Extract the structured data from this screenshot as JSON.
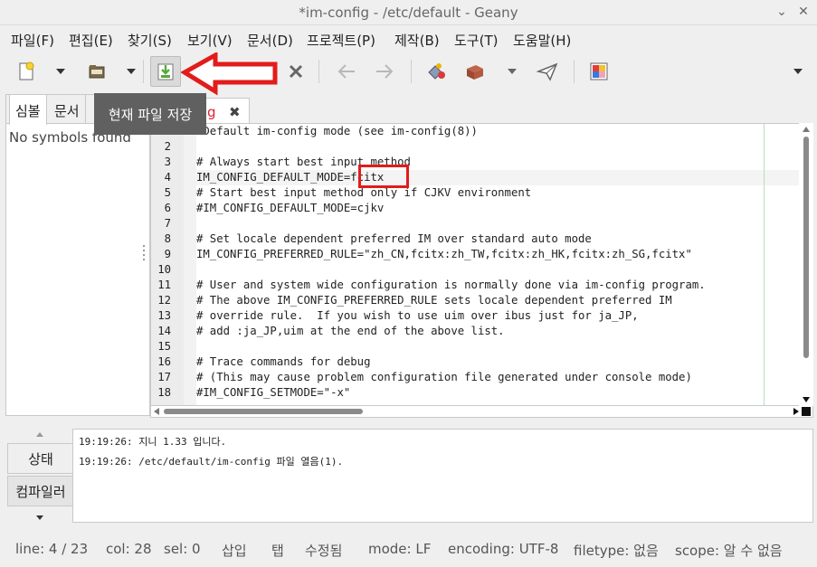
{
  "window": {
    "title": "*im-config - /etc/default - Geany",
    "minimize_glyph": "⌄",
    "close_glyph": "✕"
  },
  "menu": [
    "파일(F)",
    "편집(E)",
    "찾기(S)",
    "보기(V)",
    "문서(D)",
    "프로젝트(P)",
    "제작(B)",
    "도구(T)",
    "도움말(H)"
  ],
  "toolbar": {
    "tooltip": "현재 파일 저장",
    "icons": [
      "new-file-icon",
      "open-file-icon",
      "save-icon",
      "save-all-icon",
      "revert-icon",
      "close-file-icon",
      "back-arrow-icon",
      "forward-arrow-icon",
      "compile-icon",
      "build-icon",
      "run-icon",
      "color-chooser-icon"
    ]
  },
  "sidebar": {
    "tabs": [
      "심볼",
      "문서"
    ],
    "empty_text": "No symbols found"
  },
  "editor": {
    "tab_label": "g",
    "tab_close": "✖",
    "current_line": 4,
    "lines": [
      {
        "n": "",
        "text": " Default im-config mode (see im-config(8))"
      },
      {
        "n": "2",
        "text": ""
      },
      {
        "n": "3",
        "text": "# Always start best input method"
      },
      {
        "n": "4",
        "text": "IM_CONFIG_DEFAULT_MODE=fcitx"
      },
      {
        "n": "5",
        "text": "# Start best input method only if CJKV environment"
      },
      {
        "n": "6",
        "text": "#IM_CONFIG_DEFAULT_MODE=cjkv"
      },
      {
        "n": "7",
        "text": ""
      },
      {
        "n": "8",
        "text": "# Set locale dependent preferred IM over standard auto mode"
      },
      {
        "n": "9",
        "text": "IM_CONFIG_PREFERRED_RULE=\"zh_CN,fcitx:zh_TW,fcitx:zh_HK,fcitx:zh_SG,fcitx\""
      },
      {
        "n": "10",
        "text": ""
      },
      {
        "n": "11",
        "text": "# User and system wide configuration is normally done via im-config program."
      },
      {
        "n": "12",
        "text": "# The above IM_CONFIG_PREFERRED_RULE sets locale dependent preferred IM"
      },
      {
        "n": "13",
        "text": "# override rule.  If you wish to use uim over ibus just for ja_JP,"
      },
      {
        "n": "14",
        "text": "# add :ja_JP,uim at the end of the above list."
      },
      {
        "n": "15",
        "text": ""
      },
      {
        "n": "16",
        "text": "# Trace commands for debug"
      },
      {
        "n": "17",
        "text": "# (This may cause problem configuration file generated under console mode)"
      },
      {
        "n": "18",
        "text": "#IM_CONFIG_SETMODE=\"-x\""
      }
    ]
  },
  "messages": {
    "tabs": [
      "상태",
      "컴파일러"
    ],
    "lines": [
      "19:19:26: 지니 1.33 입니다.",
      "19:19:26: /etc/default/im-config 파일 열음(1)."
    ]
  },
  "status": {
    "line": "line: 4 / 23",
    "col": "col: 28",
    "sel": "sel: 0",
    "insert": "삽입",
    "tab": "탭",
    "modified": "수정됨",
    "mode": "mode: LF",
    "encoding": "encoding: UTF-8",
    "filetype": "filetype: 없음",
    "scope": "scope: 알 수 없음"
  },
  "colors": {
    "highlight": "#e21b1b",
    "accent_green": "#5aa83c"
  }
}
